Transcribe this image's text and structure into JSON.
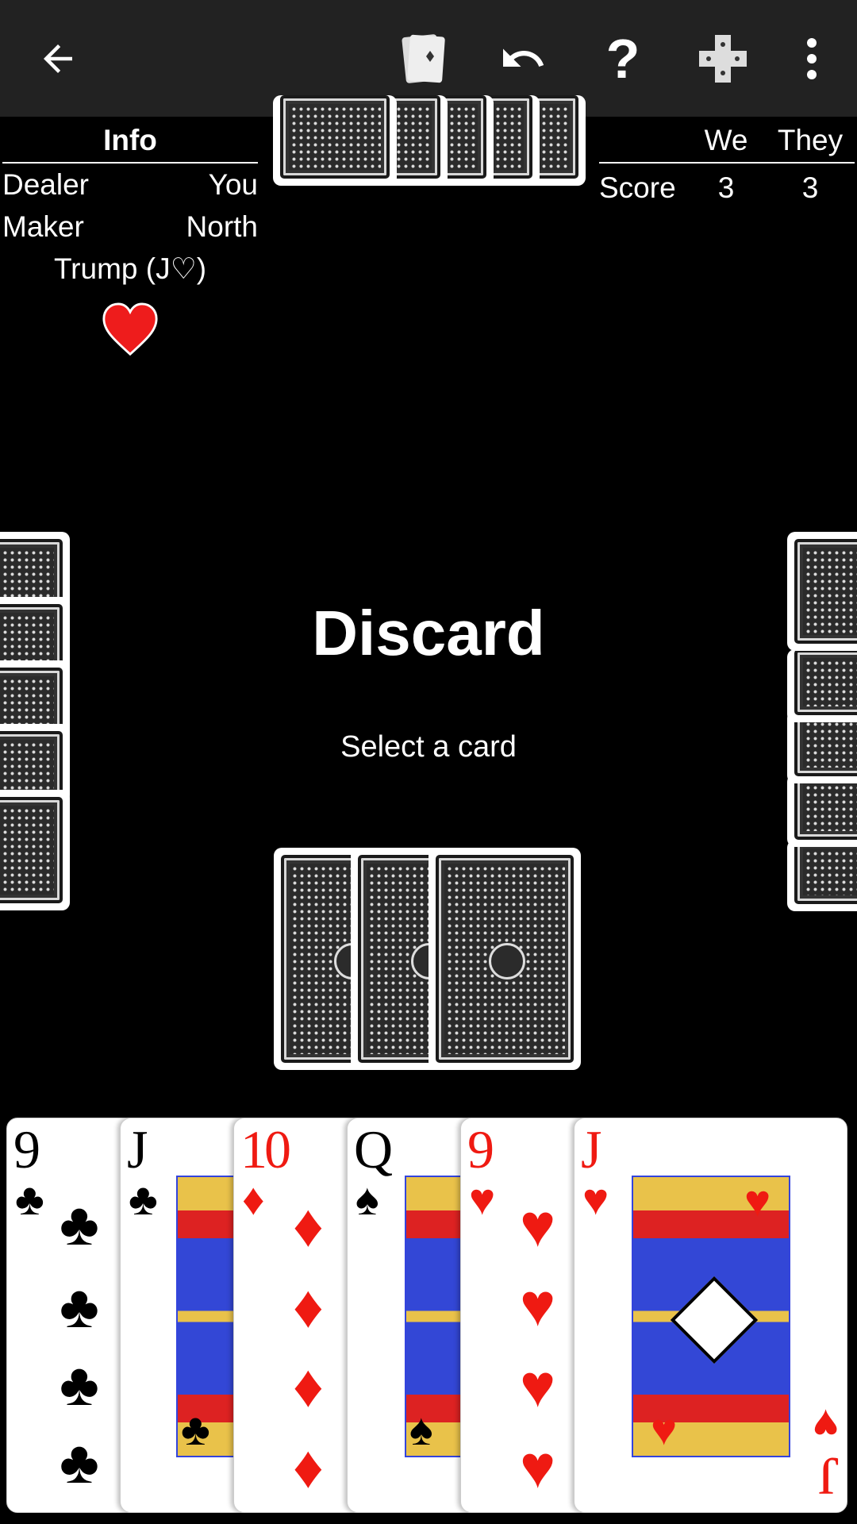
{
  "toolbar": {
    "icons": [
      "back-arrow-icon",
      "cards-icon",
      "undo-icon",
      "help-icon",
      "dpad-icon",
      "more-vert-icon"
    ]
  },
  "info": {
    "title": "Info",
    "dealer_label": "Dealer",
    "dealer_value": "You",
    "maker_label": "Maker",
    "maker_value": "North",
    "trump_label": "Trump (J♡)",
    "trump_suit_icon": "heart-icon"
  },
  "score": {
    "col_we": "We",
    "col_they": "They",
    "row_label": "Score",
    "we_value": "3",
    "they_value": "3"
  },
  "center": {
    "phase": "Discard",
    "prompt": "Select a card"
  },
  "hand": [
    {
      "rank": "9",
      "suit": "♣",
      "color": "#000000"
    },
    {
      "rank": "J",
      "suit": "♣",
      "color": "#000000"
    },
    {
      "rank": "10",
      "suit": "♦",
      "color": "#ef1a12"
    },
    {
      "rank": "Q",
      "suit": "♠",
      "color": "#000000"
    },
    {
      "rank": "9",
      "suit": "♥",
      "color": "#ef1a12"
    },
    {
      "rank": "J",
      "suit": "♥",
      "color": "#ef1a12"
    }
  ]
}
